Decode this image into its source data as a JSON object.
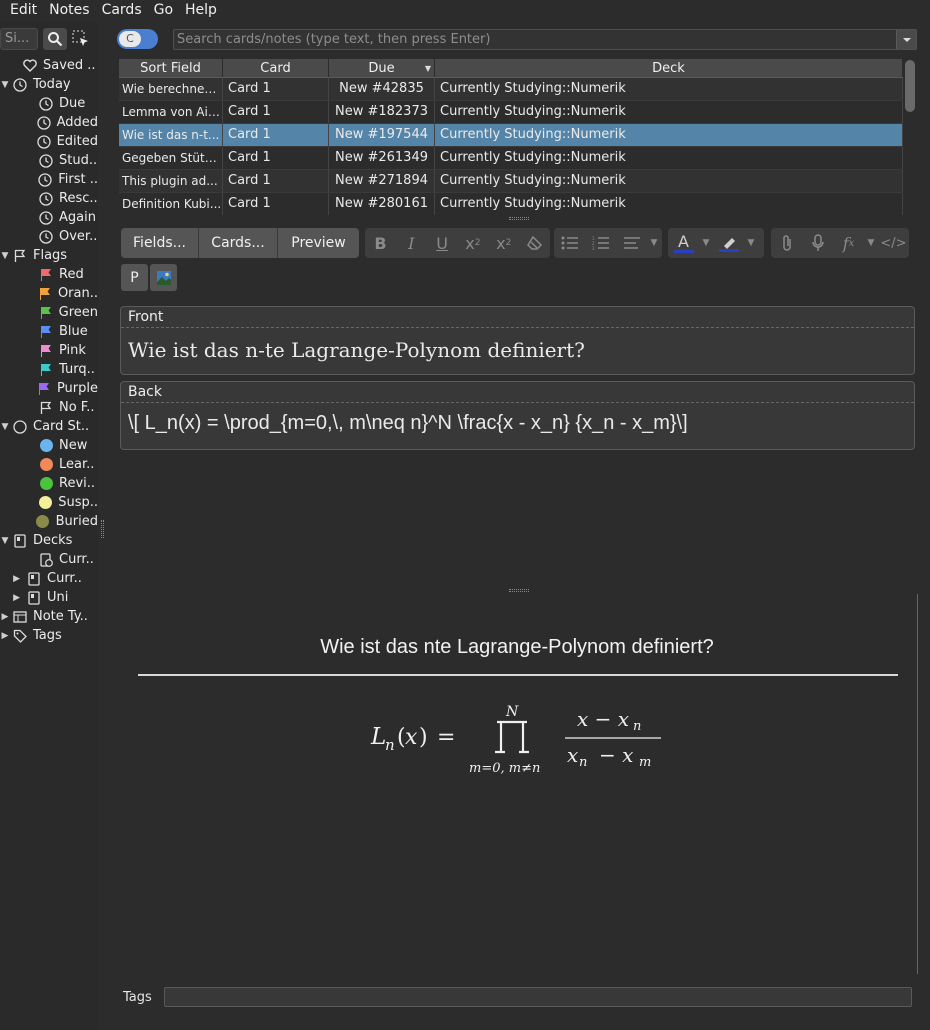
{
  "menu": [
    "Edit",
    "Notes",
    "Cards",
    "Go",
    "Help"
  ],
  "sidebar": {
    "search_placeholder": "Si...",
    "items": [
      {
        "label": "Saved ..",
        "indent": 1
      },
      {
        "label": "Today",
        "indent": 0
      },
      {
        "label": "Due",
        "indent": 1
      },
      {
        "label": "Added",
        "indent": 1
      },
      {
        "label": "Edited",
        "indent": 1
      },
      {
        "label": "Stud..",
        "indent": 1
      },
      {
        "label": "First ..",
        "indent": 1
      },
      {
        "label": "Resc..",
        "indent": 1
      },
      {
        "label": "Again",
        "indent": 1
      },
      {
        "label": "Over..",
        "indent": 1
      },
      {
        "label": "Flags",
        "indent": 0
      },
      {
        "label": "Red",
        "indent": 1
      },
      {
        "label": "Oran..",
        "indent": 1
      },
      {
        "label": "Green",
        "indent": 1
      },
      {
        "label": "Blue",
        "indent": 1
      },
      {
        "label": "Pink",
        "indent": 1
      },
      {
        "label": "Turq..",
        "indent": 1
      },
      {
        "label": "Purple",
        "indent": 1
      },
      {
        "label": "No F..",
        "indent": 1
      },
      {
        "label": "Card St..",
        "indent": 0
      },
      {
        "label": "New",
        "indent": 1
      },
      {
        "label": "Lear..",
        "indent": 1
      },
      {
        "label": "Revi..",
        "indent": 1
      },
      {
        "label": "Susp..",
        "indent": 1
      },
      {
        "label": "Buried",
        "indent": 1
      },
      {
        "label": "Decks",
        "indent": 0
      },
      {
        "label": "Curr..",
        "indent": 1
      },
      {
        "label": "Curr..",
        "indent": 1
      },
      {
        "label": "Uni",
        "indent": 1
      },
      {
        "label": "Note Ty..",
        "indent": 0
      },
      {
        "label": "Tags",
        "indent": 0
      }
    ],
    "colors": {
      "flag_red": "#f06a6a",
      "flag_orange": "#f0a33c",
      "flag_green": "#5ac14a",
      "flag_blue": "#5b8ef0",
      "flag_pink": "#f08ad0",
      "flag_turquoise": "#3cc9c9",
      "flag_purple": "#9a6af0",
      "state_new": "#6ab4f0",
      "state_learn": "#f08a5a",
      "state_review": "#4ac43c",
      "state_suspended": "#f0f09a",
      "state_buried": "#8a8a4a"
    }
  },
  "toggle": {
    "label": "C"
  },
  "search": {
    "placeholder": "Search cards/notes (type text, then press Enter)"
  },
  "table": {
    "columns": [
      "Sort Field",
      "Card",
      "Due",
      "Deck"
    ],
    "rows": [
      [
        "Wie berechnen...",
        "Card 1",
        "New #42835",
        "Currently Studying::Numerik"
      ],
      [
        "Lemma von Ait...",
        "Card 1",
        "New #182373",
        "Currently Studying::Numerik"
      ],
      [
        "Wie ist das n-t...",
        "Card 1",
        "New #197544",
        "Currently Studying::Numerik"
      ],
      [
        "Gegeben Stütz...",
        "Card 1",
        "New #261349",
        "Currently Studying::Numerik"
      ],
      [
        "This plugin ad...",
        "Card 1",
        "New #271894",
        "Currently Studying::Numerik"
      ],
      [
        "Definition Kubi...",
        "Card 1",
        "New #280161",
        "Currently Studying::Numerik"
      ]
    ],
    "selected_row": 2,
    "selected_color": "#5485a8"
  },
  "editor": {
    "fields_button": "Fields...",
    "cards_button": "Cards...",
    "preview_button": "Preview",
    "p_button": "P",
    "fields": [
      {
        "name": "Front",
        "value": "Wie ist das n-te Lagrange-Polynom definiert?"
      },
      {
        "name": "Back",
        "value": "\\[ L_n(x) = \\prod_{m=0,\\, m\\neq n}^N \\frac{x - x_n} {x_n - x_m}\\]"
      }
    ]
  },
  "preview": {
    "front": "Wie ist das nte Lagrange-Polynom definiert?"
  },
  "tags": {
    "label": "Tags",
    "value": ""
  }
}
